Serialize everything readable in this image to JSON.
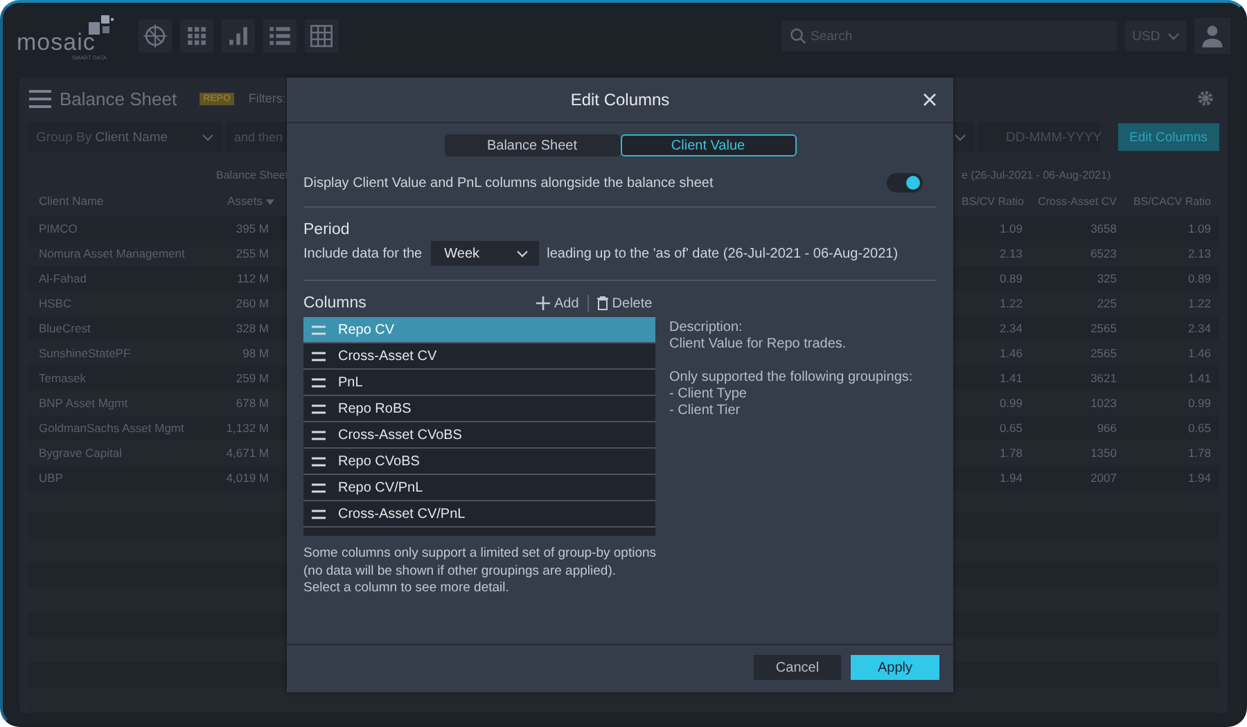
{
  "app": {
    "logo": {
      "name": "mosaic",
      "tagline": "SMART DATA"
    },
    "search": {
      "placeholder": "Search"
    },
    "currency": "USD"
  },
  "panel": {
    "title": "Balance Sheet",
    "badge": "REPO",
    "filters_label": "Filters:",
    "group_by": {
      "label": "Group By",
      "value": "Client Name"
    },
    "then_by": {
      "placeholder": "and then"
    },
    "date": {
      "placeholder": "DD-MMM-YYYY"
    },
    "edit_button": "Edit Columns"
  },
  "table": {
    "left_group": "Balance Sheet",
    "right_group": "e (26-Jul-2021 - 06-Aug-2021)",
    "left_columns": [
      "Client Name",
      "Assets"
    ],
    "right_columns": [
      "BS/CV Ratio",
      "Cross-Asset CV",
      "BS/CACV Ratio"
    ],
    "rows": [
      {
        "client": "PIMCO",
        "assets": "395 M",
        "bs_cv_ratio": "1.09",
        "cross_asset_cv": "3658",
        "bs_cacv_ratio": "1.09"
      },
      {
        "client": "Nomura Asset Management",
        "assets": "255 M",
        "bs_cv_ratio": "2.13",
        "cross_asset_cv": "6523",
        "bs_cacv_ratio": "2.13"
      },
      {
        "client": "Al-Fahad",
        "assets": "112 M",
        "bs_cv_ratio": "0.89",
        "cross_asset_cv": "325",
        "bs_cacv_ratio": "0.89"
      },
      {
        "client": "HSBC",
        "assets": "260 M",
        "bs_cv_ratio": "1.22",
        "cross_asset_cv": "225",
        "bs_cacv_ratio": "1.22"
      },
      {
        "client": "BlueCrest",
        "assets": "328 M",
        "bs_cv_ratio": "2.34",
        "cross_asset_cv": "2565",
        "bs_cacv_ratio": "2.34"
      },
      {
        "client": "SunshineStatePF",
        "assets": "98 M",
        "bs_cv_ratio": "1.46",
        "cross_asset_cv": "2565",
        "bs_cacv_ratio": "1.46"
      },
      {
        "client": "Temasek",
        "assets": "259 M",
        "bs_cv_ratio": "1.41",
        "cross_asset_cv": "3621",
        "bs_cacv_ratio": "1.41"
      },
      {
        "client": "BNP Asset Mgmt",
        "assets": "678 M",
        "bs_cv_ratio": "0.99",
        "cross_asset_cv": "1023",
        "bs_cacv_ratio": "0.99"
      },
      {
        "client": "GoldmanSachs Asset Mgmt",
        "assets": "1,132 M",
        "bs_cv_ratio": "0.65",
        "cross_asset_cv": "966",
        "bs_cacv_ratio": "0.65"
      },
      {
        "client": "Bygrave Capital",
        "assets": "4,671 M",
        "bs_cv_ratio": "1.78",
        "cross_asset_cv": "1350",
        "bs_cacv_ratio": "1.78"
      },
      {
        "client": "UBP",
        "assets": "4,019 M",
        "bs_cv_ratio": "1.94",
        "cross_asset_cv": "2007",
        "bs_cacv_ratio": "1.94"
      }
    ]
  },
  "dialog": {
    "title": "Edit Columns",
    "tabs": [
      {
        "label": "Balance Sheet",
        "selected": false
      },
      {
        "label": "Client Value",
        "selected": true
      }
    ],
    "toggle": {
      "label": "Display Client Value and PnL columns alongside the balance sheet",
      "on": true
    },
    "period": {
      "heading": "Period",
      "prefix": "Include data for the",
      "value": "Week",
      "suffix": "leading up to the 'as of' date (26-Jul-2021 - 06-Aug-2021)"
    },
    "columns": {
      "heading": "Columns",
      "add": "Add",
      "delete": "Delete",
      "items": [
        {
          "label": "Repo CV",
          "selected": true
        },
        {
          "label": "Cross-Asset CV",
          "selected": false
        },
        {
          "label": "PnL",
          "selected": false
        },
        {
          "label": "Repo RoBS",
          "selected": false
        },
        {
          "label": "Cross-Asset CVoBS",
          "selected": false
        },
        {
          "label": "Repo CVoBS",
          "selected": false
        },
        {
          "label": "Repo CV/PnL",
          "selected": false
        },
        {
          "label": "Cross-Asset CV/PnL",
          "selected": false
        }
      ],
      "description_label": "Description:",
      "description": "Client Value for Repo trades.",
      "groupings_label": "Only supported the following groupings:",
      "groupings": [
        "- Client Type",
        "- Client Tier"
      ],
      "note": "Some columns only support a limited set of group-by options\n(no data will be shown if other groupings are applied).\nSelect a column to see more detail."
    },
    "cancel": "Cancel",
    "apply": "Apply"
  }
}
